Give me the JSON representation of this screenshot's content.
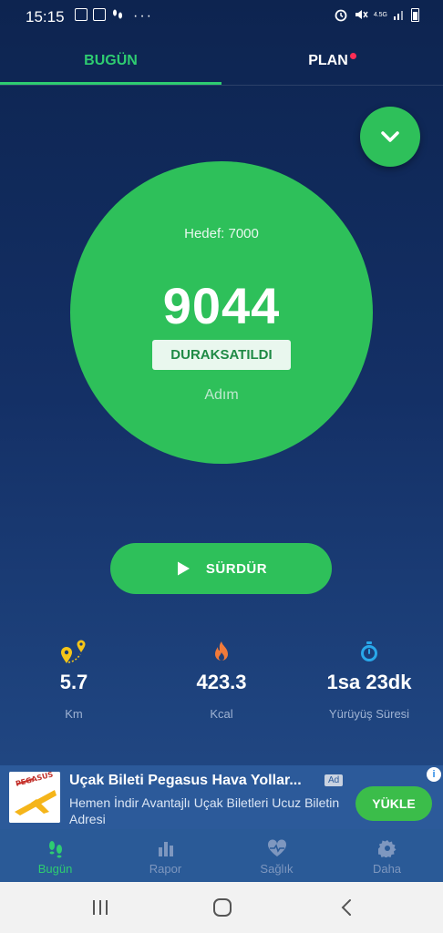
{
  "status": {
    "time": "15:15",
    "network": "4.5G",
    "more": "···"
  },
  "tabs": [
    {
      "label": "BUGÜN",
      "active": true
    },
    {
      "label": "PLAN",
      "has_notification": true
    }
  ],
  "counter": {
    "goal": "Hedef: 7000",
    "steps": "9044",
    "state": "DURAKSATILDI",
    "unit": "Adım"
  },
  "resume_button": {
    "label": "SÜRDÜR",
    "icon": "play-icon"
  },
  "stats": [
    {
      "icon": "map-pin-icon",
      "value": "5.7",
      "label": "Km"
    },
    {
      "icon": "flame-icon",
      "value": "423.3",
      "label": "Kcal"
    },
    {
      "icon": "stopwatch-icon",
      "value": "1sa 23dk",
      "label": "Yürüyüş Süresi"
    }
  ],
  "ad": {
    "title": "Uçak Bileti Pegasus Hava Yollar...",
    "badge": "Ad",
    "description": "Hemen İndir Avantajlı Uçak Biletleri Ucuz Biletin Adresi",
    "cta": "YÜKLE",
    "image_text": "PEGASUS"
  },
  "bottom_nav": [
    {
      "label": "Bugün",
      "icon": "footsteps-icon",
      "active": true
    },
    {
      "label": "Rapor",
      "icon": "bar-chart-icon"
    },
    {
      "label": "Sağlık",
      "icon": "heart-pulse-icon"
    },
    {
      "label": "Daha",
      "icon": "gear-icon"
    }
  ],
  "colors": {
    "accent": "#2ec05a",
    "tab_active": "#2ecc71",
    "background_top": "#0d2450",
    "background_bottom": "#254c88",
    "ad_background": "#2c5a9a",
    "notification_dot": "#ff2d55"
  }
}
